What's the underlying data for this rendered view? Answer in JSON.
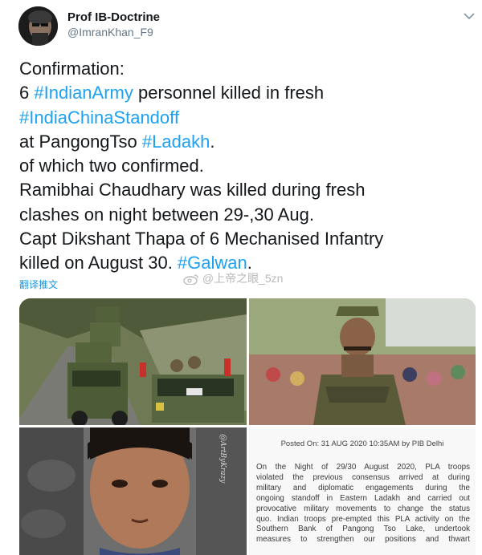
{
  "author": {
    "name": "Prof IB-Doctrine",
    "handle": "@ImranKhan_F9"
  },
  "tweet": {
    "line1": "Confirmation:",
    "line2_pre": "6 ",
    "tag_army": "#IndianArmy",
    "line2_post": " personnel killed in fresh",
    "tag_standoff": "#IndiaChinaStandoff",
    "line4_pre": "at PangongTso ",
    "tag_ladakh": "#Ladakh",
    "line4_post": ".",
    "line5": "of which two confirmed.",
    "line6": "Ramibhai Chaudhary was killed during fresh",
    "line7": "clashes on night between 29-,30 Aug.",
    "line8": "Capt Dikshant Thapa of 6 Mechanised Infantry",
    "line9_pre": "killed on August 30. ",
    "tag_galwan": "#Galwan",
    "line9_post": "."
  },
  "translate_label": "翻译推文",
  "watermark": "@上帝之眼_5zn",
  "photo_watermark": "@ArtByKrazy",
  "pib": {
    "posted": "Posted On: 31 AUG 2020 10:35AM by PIB Delhi",
    "lines": [
      "On the Night of 29/30 August 2020, PLA troops",
      "violated the previous consensus arrived at during",
      "military and diplomatic engagements during the",
      "ongoing standoff in Eastern Ladakh and carried out",
      "provocative military movements to change the status",
      "quo. Indian troops pre-empted this PLA activity on the",
      "Southern Bank of Pangong Tso Lake, undertook",
      "measures to strengthen our positions and thwart"
    ]
  },
  "colors": {
    "link": "#1da1f2",
    "text": "#14171a",
    "muted": "#657786"
  },
  "icons": [
    "chevron-down-icon",
    "weibo-icon"
  ]
}
